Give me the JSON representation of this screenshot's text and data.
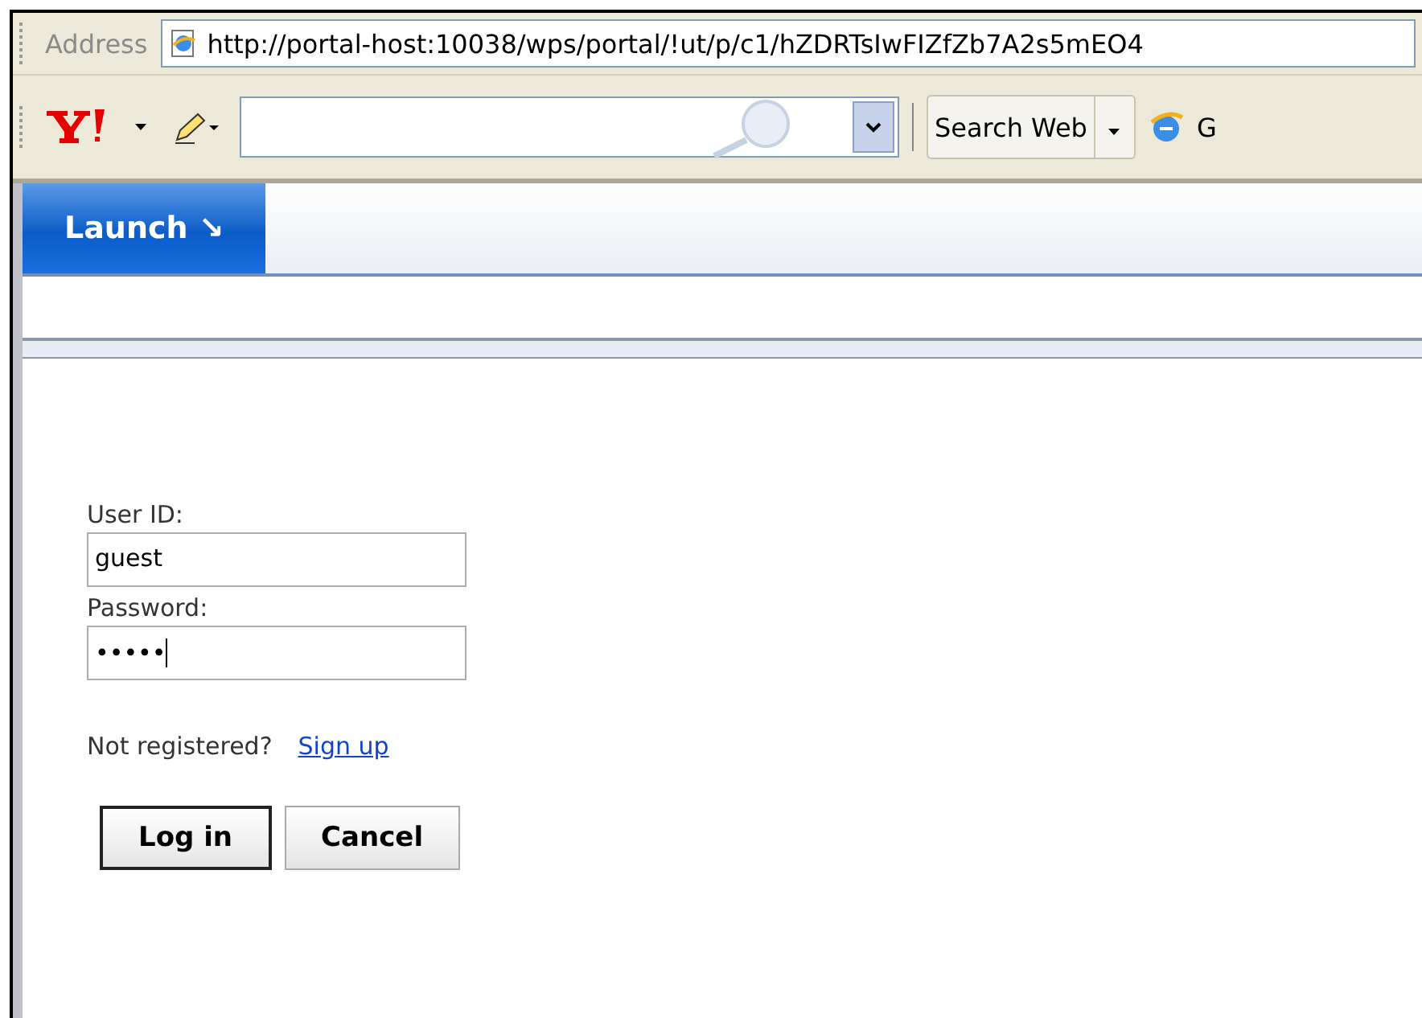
{
  "address_bar": {
    "label": "Address",
    "url": "http://portal-host:10038/wps/portal/!ut/p/c1/hZDRTsIwFIZfZb7A2s5mEO4"
  },
  "toolbar": {
    "search_button": "Search Web",
    "go_button": "G"
  },
  "nav": {
    "tabs": [
      {
        "label": "Launch ↘",
        "selected": true
      }
    ]
  },
  "login": {
    "user_label": "User ID:",
    "user_value": "guest",
    "password_label": "Password:",
    "password_value": "•••••",
    "register_text": "Not registered?",
    "register_link": "Sign up",
    "buttons": [
      {
        "label": "Log in",
        "default": true
      },
      {
        "label": "Cancel",
        "default": false
      }
    ]
  }
}
